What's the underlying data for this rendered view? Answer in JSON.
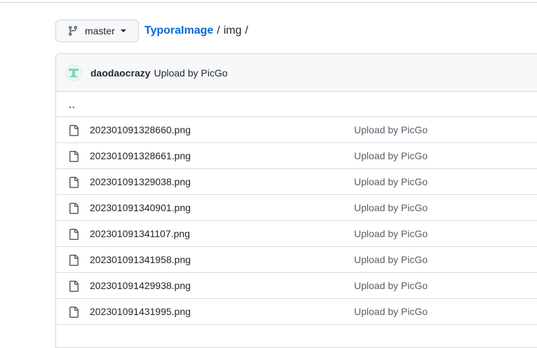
{
  "branch": {
    "label": "master",
    "icon": "git-branch-icon"
  },
  "breadcrumb": {
    "repo": "TyporaImage",
    "separator": "/",
    "folder": "img",
    "trailing": "/"
  },
  "commit": {
    "author": "daodaocrazy",
    "message": "Upload by PicGo",
    "avatar_color": "#7fd3b3"
  },
  "parent_link": "..",
  "files": [
    {
      "name": "202301091328660.png",
      "commit": "Upload by PicGo"
    },
    {
      "name": "202301091328661.png",
      "commit": "Upload by PicGo"
    },
    {
      "name": "202301091329038.png",
      "commit": "Upload by PicGo"
    },
    {
      "name": "202301091340901.png",
      "commit": "Upload by PicGo"
    },
    {
      "name": "202301091341107.png",
      "commit": "Upload by PicGo"
    },
    {
      "name": "202301091341958.png",
      "commit": "Upload by PicGo"
    },
    {
      "name": "202301091429938.png",
      "commit": "Upload by PicGo"
    },
    {
      "name": "202301091431995.png",
      "commit": "Upload by PicGo"
    }
  ],
  "colors": {
    "link": "#0969da",
    "muted": "#57606a",
    "border": "#d0d7de"
  }
}
